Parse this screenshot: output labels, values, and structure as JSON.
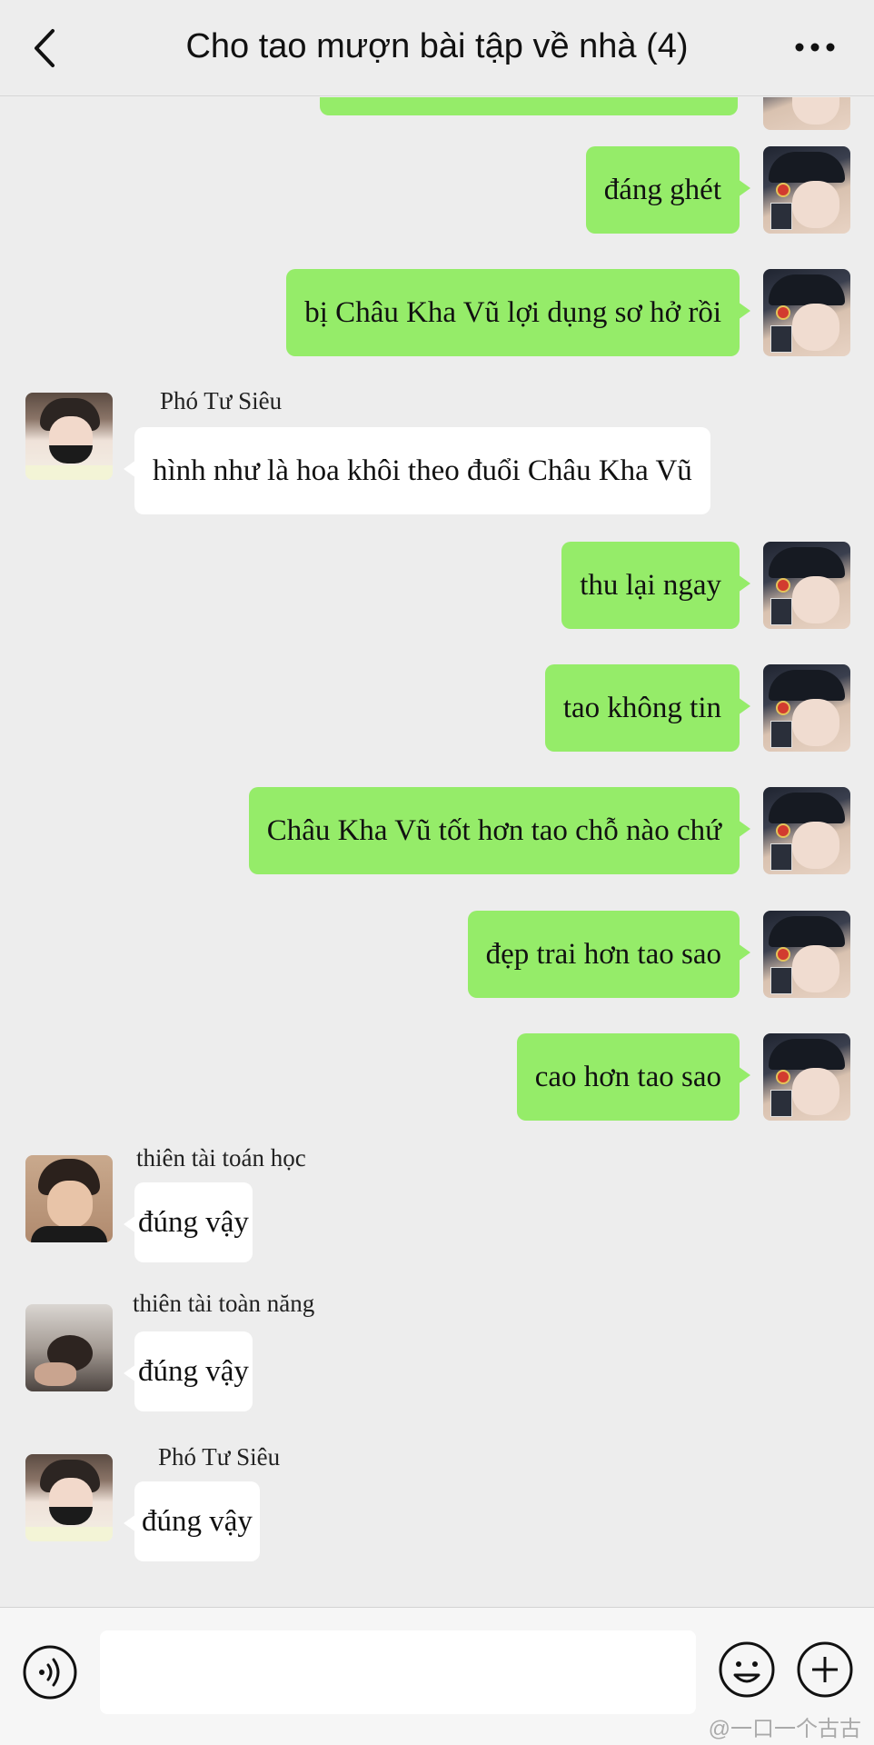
{
  "header": {
    "title": "Cho tao mượn bài tập về nhà (4)"
  },
  "messages": [
    {
      "side": "out",
      "text": "đáng ghét"
    },
    {
      "side": "out",
      "text": "bị Châu Kha Vũ lợi dụng sơ hở rồi"
    },
    {
      "side": "in",
      "sender": "Phó Tư Siêu",
      "text": "hình như là hoa khôi theo đuổi Châu Kha Vũ"
    },
    {
      "side": "out",
      "text": "thu lại ngay"
    },
    {
      "side": "out",
      "text": "tao không tin"
    },
    {
      "side": "out",
      "text": "Châu Kha Vũ tốt hơn tao chỗ nào chứ"
    },
    {
      "side": "out",
      "text": "đẹp trai hơn tao sao"
    },
    {
      "side": "out",
      "text": "cao hơn tao sao"
    },
    {
      "side": "in",
      "sender": "thiên tài toán học",
      "text": "đúng vậy"
    },
    {
      "side": "in",
      "sender": "thiên tài toàn năng",
      "text": "đúng vậy"
    },
    {
      "side": "in",
      "sender": "Phó Tư Siêu",
      "text": "đúng vậy"
    }
  ],
  "icons": {
    "back": "chevron-left-icon",
    "more": "more-dots-icon",
    "voice": "voice-icon",
    "emoji": "emoji-icon",
    "plus": "plus-icon"
  },
  "colors": {
    "outgoing_bubble": "#95ec69",
    "incoming_bubble": "#ffffff",
    "background": "#ededed"
  },
  "watermark": "@一口一个古古"
}
